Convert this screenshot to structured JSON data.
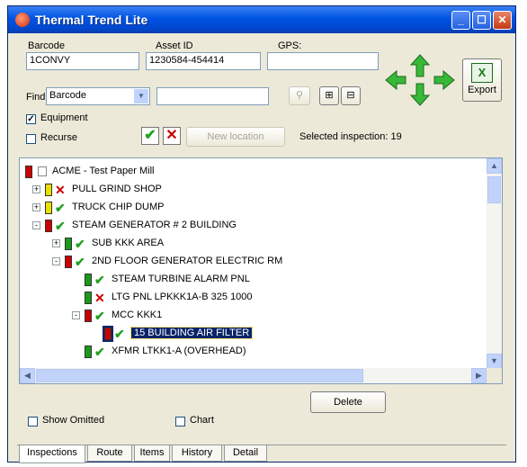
{
  "window": {
    "title": "Thermal Trend Lite"
  },
  "header": {
    "barcode_label": "Barcode",
    "barcode_value": "1CONVY",
    "asset_label": "Asset ID",
    "asset_value": "1230584-454414",
    "gps_label": "GPS:",
    "gps_value": "",
    "find_label": "Find:",
    "find_option": "Barcode",
    "find_value": "",
    "equipment_label": "Equipment",
    "equipment_checked": true,
    "recurse_label": "Recurse",
    "recurse_checked": false,
    "new_location_label": "New location",
    "selected_inspection_text": "Selected inspection: 19",
    "export_label": "Export"
  },
  "tree": {
    "nodes": [
      {
        "label": "ACME - Test Paper Mill",
        "expander": "",
        "status_color": "#cc0000",
        "flag": "none"
      },
      {
        "label": "PULL GRIND SHOP",
        "expander": "+",
        "status_color": "#e8e000",
        "flag": "x"
      },
      {
        "label": "TRUCK CHIP DUMP",
        "expander": "+",
        "status_color": "#e8e000",
        "flag": "check"
      },
      {
        "label": "STEAM GENERATOR # 2 BUILDING",
        "expander": "-",
        "status_color": "#cc0000",
        "flag": "check"
      },
      {
        "label": "SUB KKK AREA",
        "expander": "+",
        "status_color": "#1a9a1a",
        "flag": "check"
      },
      {
        "label": "2ND FLOOR GENERATOR ELECTRIC RM",
        "expander": "-",
        "status_color": "#cc0000",
        "flag": "check"
      },
      {
        "label": "STEAM TURBINE ALARM PNL",
        "expander": "",
        "status_color": "#1a9a1a",
        "flag": "check"
      },
      {
        "label": "LTG PNL LPKKK1A-B 325 1000",
        "expander": "",
        "status_color": "#1a9a1a",
        "flag": "x"
      },
      {
        "label": "MCC KKK1",
        "expander": "-",
        "status_color": "#cc0000",
        "flag": "check"
      },
      {
        "label": "15 BUILDING AIR FILTER",
        "expander": "",
        "status_color": "#cc0000",
        "flag": "check"
      },
      {
        "label": "XFMR LTKK1-A (OVERHEAD)",
        "expander": "",
        "status_color": "#1a9a1a",
        "flag": "check"
      }
    ]
  },
  "footer": {
    "delete_label": "Delete",
    "show_omitted_label": "Show Omitted",
    "chart_label": "Chart"
  },
  "tabs": [
    {
      "label": "Inspections"
    },
    {
      "label": "Route"
    },
    {
      "label": "Items"
    },
    {
      "label": "History"
    },
    {
      "label": "Detail"
    }
  ],
  "colors": {
    "titlebar": "#0054e3",
    "selection": "#0a246a",
    "ok": "#21a121",
    "alarm": "#cc0000"
  }
}
